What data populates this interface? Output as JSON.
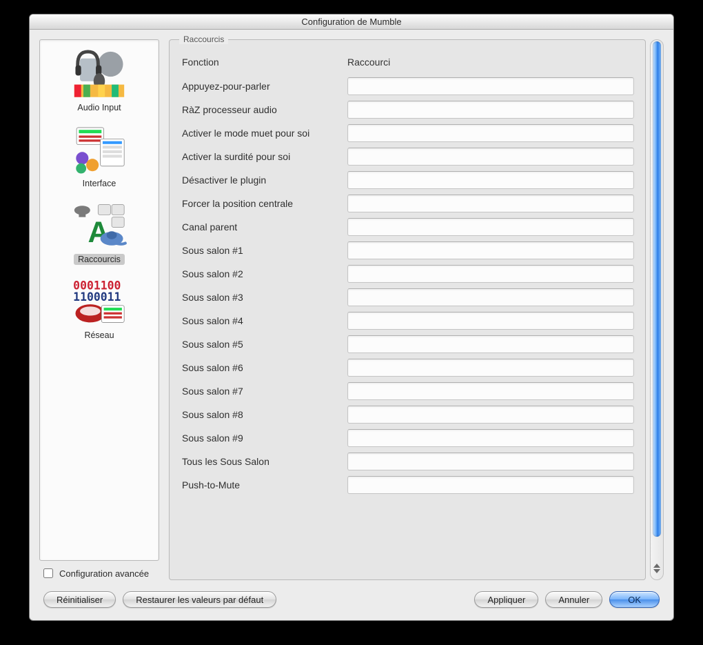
{
  "window": {
    "title": "Configuration de Mumble"
  },
  "sidebar": {
    "items": [
      {
        "id": "audio-input",
        "label": "Audio Input",
        "selected": false
      },
      {
        "id": "interface",
        "label": "Interface",
        "selected": false
      },
      {
        "id": "raccourcis",
        "label": "Raccourcis",
        "selected": true
      },
      {
        "id": "reseau",
        "label": "Réseau",
        "selected": false
      }
    ],
    "advanced_checkbox_label": "Configuration avancée",
    "advanced_checked": false
  },
  "shortcuts_panel": {
    "group_title": "Raccourcis",
    "header_function": "Fonction",
    "header_shortcut": "Raccourci",
    "rows": [
      {
        "label": "Appuyez-pour-parler",
        "value": ""
      },
      {
        "label": "RàZ processeur audio",
        "value": ""
      },
      {
        "label": "Activer le mode muet pour soi",
        "value": ""
      },
      {
        "label": "Activer la surdité pour soi",
        "value": ""
      },
      {
        "label": "Désactiver le plugin",
        "value": ""
      },
      {
        "label": "Forcer la position centrale",
        "value": ""
      },
      {
        "label": "Canal parent",
        "value": ""
      },
      {
        "label": "Sous salon #1",
        "value": ""
      },
      {
        "label": "Sous salon #2",
        "value": ""
      },
      {
        "label": "Sous salon #3",
        "value": ""
      },
      {
        "label": "Sous salon #4",
        "value": ""
      },
      {
        "label": "Sous salon #5",
        "value": ""
      },
      {
        "label": "Sous salon #6",
        "value": ""
      },
      {
        "label": "Sous salon #7",
        "value": ""
      },
      {
        "label": "Sous salon #8",
        "value": ""
      },
      {
        "label": "Sous salon #9",
        "value": ""
      },
      {
        "label": "Tous les Sous Salon",
        "value": ""
      },
      {
        "label": "Push-to-Mute",
        "value": ""
      }
    ]
  },
  "buttons": {
    "reset": "Réinitialiser",
    "restore_defaults": "Restaurer les valeurs par défaut",
    "apply": "Appliquer",
    "cancel": "Annuler",
    "ok": "OK"
  }
}
